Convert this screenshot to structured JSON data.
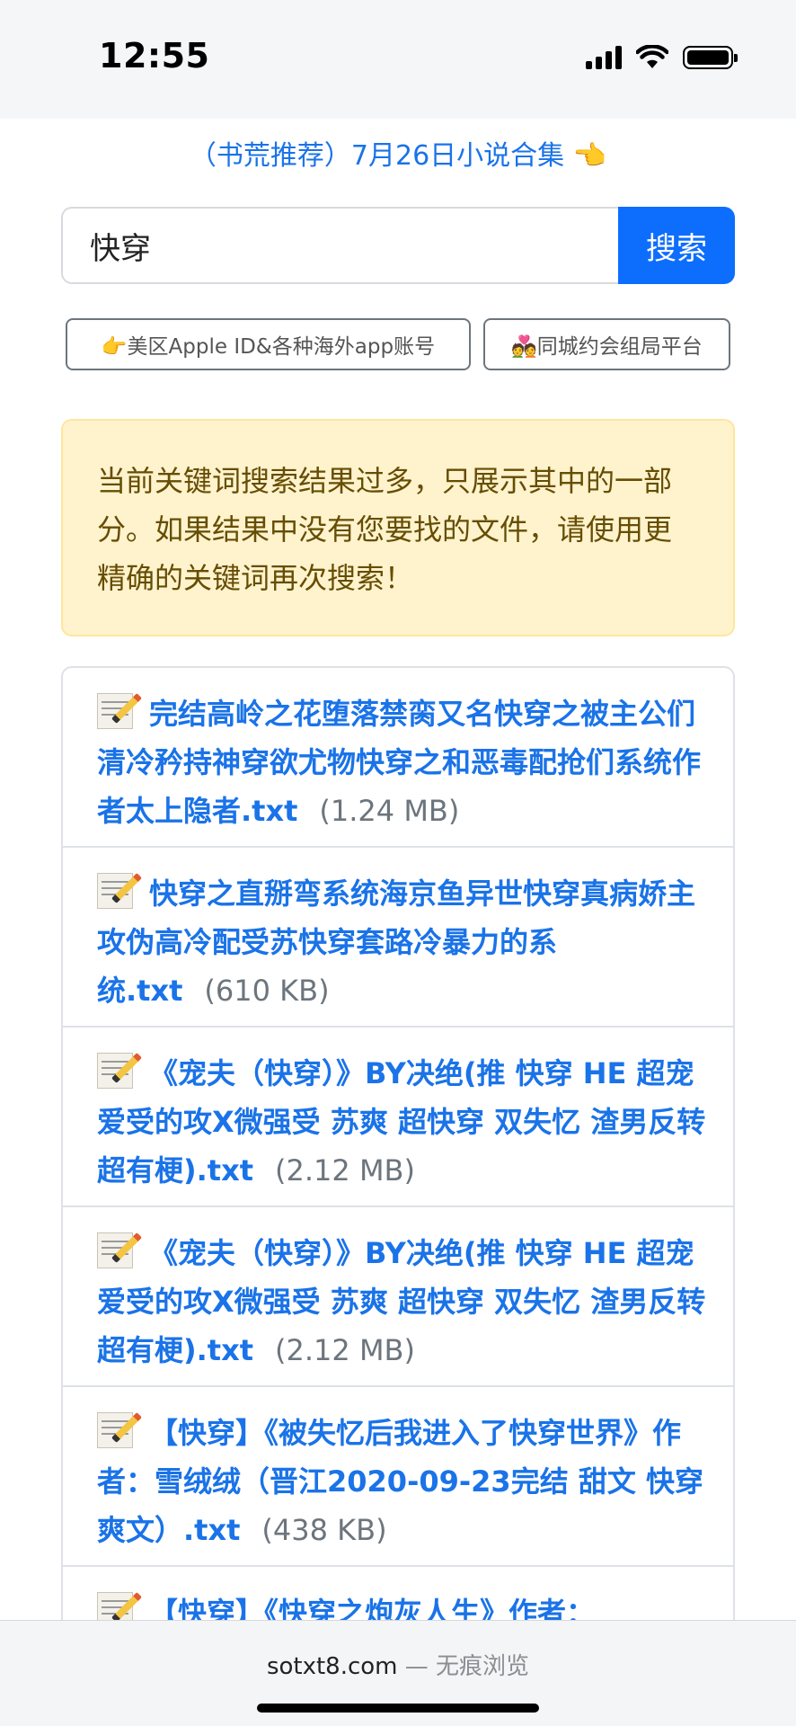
{
  "status_bar": {
    "time": "12:55",
    "icons": [
      "cellular-signal-icon",
      "wifi-icon",
      "battery-icon"
    ]
  },
  "top_link": {
    "text": "（书荒推荐）7月26日小说合集 👈"
  },
  "search": {
    "value": "快穿",
    "button_label": "搜索"
  },
  "ads": [
    {
      "label": "👉美区Apple ID&各种海外app账号"
    },
    {
      "label": "💑同城约会组局平台"
    }
  ],
  "alert": {
    "text": "当前关键词搜索结果过多，只展示其中的一部分。如果结果中没有您要找的文件，请使用更精确的关键词再次搜索！"
  },
  "results": [
    {
      "title": "完结高岭之花堕落禁脔又名快穿之被主公们清冷矜持神穿欲尤物快穿之和恶毒配抢们系统作者太上隐者.txt",
      "size": "(1.24 MB)"
    },
    {
      "title": "快穿之直掰弯系统海京鱼异世快穿真病娇主攻伪高冷配受苏快穿套路冷暴力的系统.txt",
      "size": "(610 KB)"
    },
    {
      "title": "《宠夫（快穿）》BY决绝(推 快穿 HE 超宠爱受的攻X微强受 苏爽 超快穿 双失忆 渣男反转超有梗).txt",
      "size": "(2.12 MB)"
    },
    {
      "title": "《宠夫（快穿）》BY决绝(推 快穿 HE 超宠爱受的攻X微强受 苏爽 超快穿 双失忆 渣男反转超有梗).txt",
      "size": "(2.12 MB)"
    },
    {
      "title": "【快穿】《被失忆后我进入了快穿世界》作者：雪绒绒（晋江2020-09-23完结 甜文 快穿 爽文）.txt",
      "size": "(438 KB)"
    },
    {
      "title": "【快穿】《快穿之炮灰人生》作者：",
      "size": ""
    }
  ],
  "bottom_bar": {
    "domain": "sotxt8.com",
    "suffix": " — 无痕浏览"
  },
  "colors": {
    "link": "#1a73e8",
    "primary_button": "#0d6efd",
    "alert_bg": "#fff3cd",
    "alert_text": "#664d03"
  }
}
